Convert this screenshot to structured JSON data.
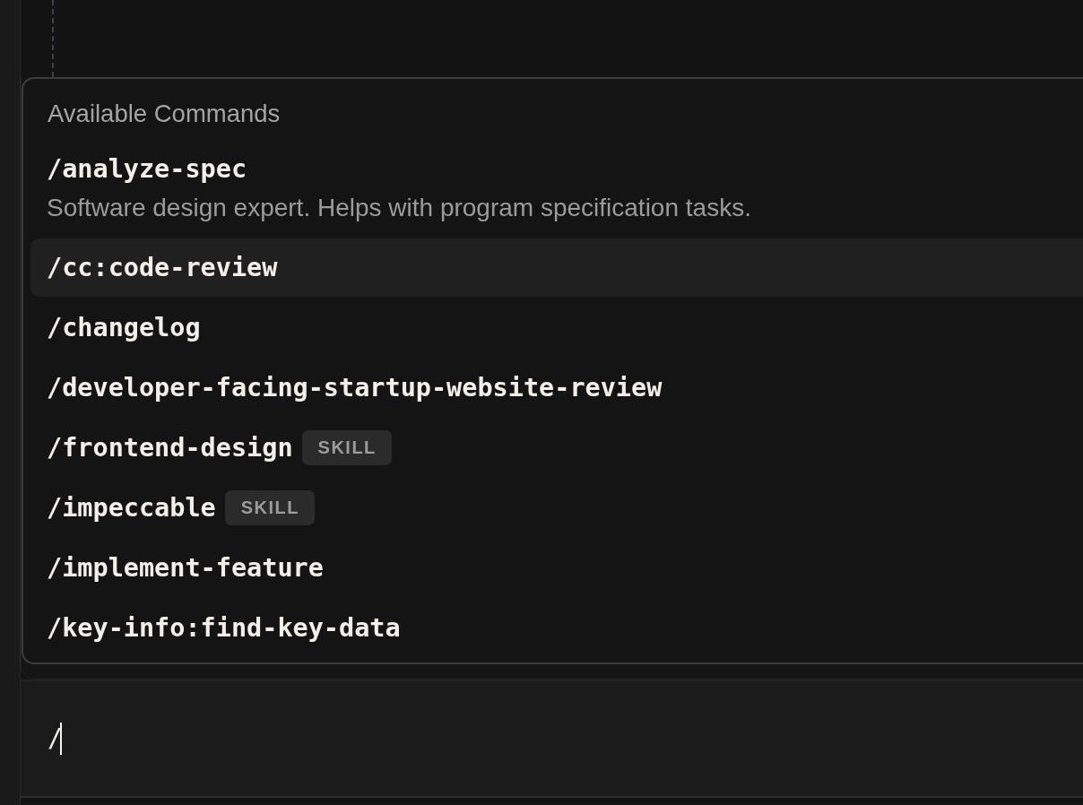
{
  "command_menu": {
    "title": "Available Commands",
    "commands": [
      {
        "name": "/analyze-spec",
        "description": "Software design expert. Helps with program specification tasks.",
        "selected": false
      },
      {
        "name": "/cc:code-review",
        "selected": true
      },
      {
        "name": "/changelog",
        "selected": false
      },
      {
        "name": "/developer-facing-startup-website-review",
        "selected": false
      },
      {
        "name": "/frontend-design",
        "badge": "SKILL",
        "selected": false
      },
      {
        "name": "/impeccable",
        "badge": "SKILL",
        "selected": false
      },
      {
        "name": "/implement-feature",
        "selected": false
      },
      {
        "name": "/key-info:find-key-data",
        "selected": false
      }
    ]
  },
  "composer": {
    "value": "/",
    "focused": true
  }
}
